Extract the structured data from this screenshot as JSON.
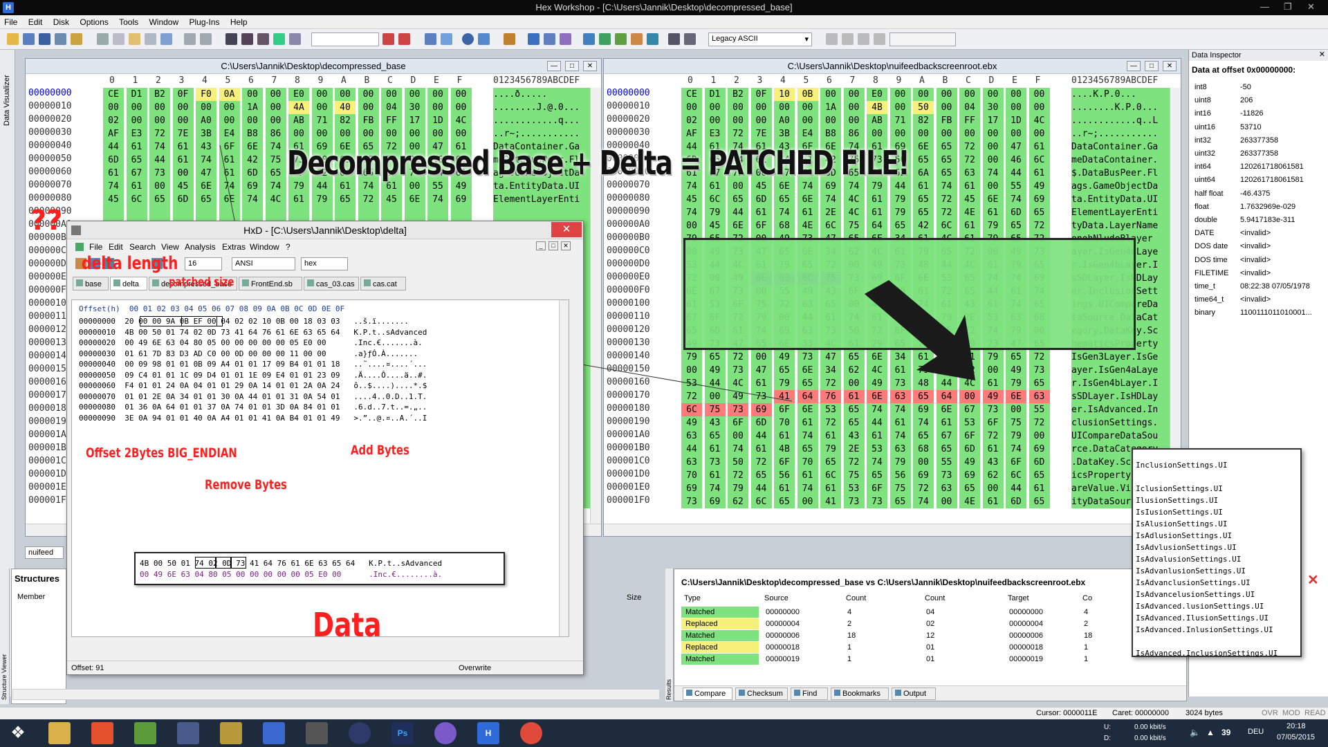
{
  "app": {
    "title": "Hex Workshop - [C:\\Users\\Jannik\\Desktop\\decompressed_base]"
  },
  "menu": [
    "File",
    "Edit",
    "Disk",
    "Options",
    "Tools",
    "Window",
    "Plug-Ins",
    "Help"
  ],
  "toolbar": {
    "encoding": "Legacy ASCII"
  },
  "leftstrip": {
    "label": "Data Visualizer"
  },
  "leftpane": {
    "title": "C:\\Users\\Jannik\\Desktop\\decompressed_base",
    "header_cols": [
      "0",
      "1",
      "2",
      "3",
      "4",
      "5",
      "6",
      "7",
      "8",
      "9",
      "A",
      "B",
      "C",
      "D",
      "E",
      "F"
    ],
    "ascii_head": "0123456789ABCDEF",
    "offsets": [
      "00000000",
      "00000010",
      "00000020",
      "00000030",
      "00000040",
      "00000050",
      "00000060",
      "00000070",
      "00000080",
      "00000090",
      "000000A0",
      "000000B0",
      "000000C0",
      "000000D0",
      "000000E0",
      "000000F0",
      "00000100",
      "00000110",
      "00000120",
      "00000130",
      "00000140",
      "00000150",
      "00000160",
      "00000170",
      "00000180",
      "00000190",
      "000001A0",
      "000001B0",
      "000001C0",
      "000001D0",
      "000001E0",
      "000001F0"
    ],
    "rows": [
      [
        "CE",
        "D1",
        "B2",
        "0F",
        "F0",
        "0A",
        "00",
        "00",
        "E0",
        "00",
        "00",
        "00",
        "00",
        "00",
        "00",
        "00"
      ],
      [
        "00",
        "00",
        "00",
        "00",
        "00",
        "00",
        "1A",
        "00",
        "4A",
        "00",
        "40",
        "00",
        "04",
        "30",
        "00",
        "00"
      ],
      [
        "02",
        "00",
        "00",
        "00",
        "A0",
        "00",
        "00",
        "00",
        "AB",
        "71",
        "82",
        "FB",
        "FF",
        "17",
        "1D",
        "4C"
      ],
      [
        "AF",
        "E3",
        "72",
        "7E",
        "3B",
        "E4",
        "B8",
        "86",
        "00",
        "00",
        "00",
        "00",
        "00",
        "00",
        "00",
        "00"
      ],
      [
        "44",
        "61",
        "74",
        "61",
        "43",
        "6F",
        "6E",
        "74",
        "61",
        "69",
        "6E",
        "65",
        "72",
        "00",
        "47",
        "61"
      ],
      [
        "6D",
        "65",
        "44",
        "61",
        "74",
        "61",
        "42",
        "75",
        "73",
        "50",
        "65",
        "65",
        "72",
        "00",
        "46",
        "6C"
      ],
      [
        "61",
        "67",
        "73",
        "00",
        "47",
        "61",
        "6D",
        "65",
        "4F",
        "62",
        "6A",
        "65",
        "63",
        "74",
        "44",
        "61"
      ],
      [
        "74",
        "61",
        "00",
        "45",
        "6E",
        "74",
        "69",
        "74",
        "79",
        "44",
        "61",
        "74",
        "61",
        "00",
        "55",
        "49"
      ],
      [
        "45",
        "6C",
        "65",
        "6D",
        "65",
        "6E",
        "74",
        "4C",
        "61",
        "79",
        "65",
        "72",
        "45",
        "6E",
        "74",
        "69"
      ]
    ],
    "ascii": [
      "....ð.....",
      "........J.@.0...",
      "............q...",
      "..r~;...........",
      "DataContainer.Ga",
      "meDataBusPeer.Fl",
      "ags.GameObjectDa",
      "ta.EntityData.UI",
      "ElementLayerEnti"
    ]
  },
  "rightpane": {
    "title": "C:\\Users\\Jannik\\Desktop\\nuifeedbackscreenroot.ebx",
    "header_cols": [
      "0",
      "1",
      "2",
      "3",
      "4",
      "5",
      "6",
      "7",
      "8",
      "9",
      "A",
      "B",
      "C",
      "D",
      "E",
      "F"
    ],
    "ascii_head": "0123456789ABCDEF",
    "offsets": [
      "00000000",
      "00000010",
      "00000020",
      "00000030",
      "00000040",
      "00000050",
      "00000060",
      "00000070",
      "00000080",
      "00000090",
      "000000A0",
      "000000B0",
      "000000C0",
      "000000D0",
      "000000E0",
      "000000F0",
      "00000100",
      "00000110",
      "00000120",
      "00000130",
      "00000140",
      "00000150",
      "00000160",
      "00000170",
      "00000180",
      "00000190",
      "000001A0",
      "000001B0",
      "000001C0",
      "000001D0",
      "000001E0",
      "000001F0"
    ],
    "rows": [
      [
        "CE",
        "D1",
        "B2",
        "0F",
        "10",
        "0B",
        "00",
        "00",
        "E0",
        "00",
        "00",
        "00",
        "00",
        "00",
        "00",
        "00"
      ],
      [
        "00",
        "00",
        "00",
        "00",
        "00",
        "00",
        "1A",
        "00",
        "4B",
        "00",
        "50",
        "00",
        "04",
        "30",
        "00",
        "00"
      ],
      [
        "02",
        "00",
        "00",
        "00",
        "A0",
        "00",
        "00",
        "00",
        "AB",
        "71",
        "82",
        "FB",
        "FF",
        "17",
        "1D",
        "4C"
      ],
      [
        "AF",
        "E3",
        "72",
        "7E",
        "3B",
        "E4",
        "B8",
        "86",
        "00",
        "00",
        "00",
        "00",
        "00",
        "00",
        "00",
        "00"
      ],
      [
        "44",
        "61",
        "74",
        "61",
        "43",
        "6F",
        "6E",
        "74",
        "61",
        "69",
        "6E",
        "65",
        "72",
        "00",
        "47",
        "61"
      ],
      [
        "6D",
        "65",
        "44",
        "61",
        "74",
        "61",
        "42",
        "75",
        "73",
        "50",
        "65",
        "65",
        "72",
        "00",
        "46",
        "6C"
      ],
      [
        "61",
        "67",
        "73",
        "00",
        "47",
        "61",
        "6D",
        "65",
        "4F",
        "62",
        "6A",
        "65",
        "63",
        "74",
        "44",
        "61"
      ],
      [
        "74",
        "61",
        "00",
        "45",
        "6E",
        "74",
        "69",
        "74",
        "79",
        "44",
        "61",
        "74",
        "61",
        "00",
        "55",
        "49"
      ],
      [
        "45",
        "6C",
        "65",
        "6D",
        "65",
        "6E",
        "74",
        "4C",
        "61",
        "79",
        "65",
        "72",
        "45",
        "6E",
        "74",
        "69"
      ],
      [
        "74",
        "79",
        "44",
        "61",
        "74",
        "61",
        "2E",
        "4C",
        "61",
        "79",
        "65",
        "72",
        "4E",
        "61",
        "6D",
        "65"
      ],
      [
        "00",
        "45",
        "6E",
        "6F",
        "68",
        "4E",
        "6C",
        "75",
        "64",
        "65",
        "42",
        "6C",
        "61",
        "79",
        "65",
        "72"
      ],
      [
        "79",
        "65",
        "72",
        "00",
        "49",
        "73",
        "47",
        "65",
        "6E",
        "34",
        "61",
        "4C",
        "61",
        "79",
        "65",
        "72"
      ],
      [
        "00",
        "49",
        "73",
        "47",
        "65",
        "6E",
        "34",
        "62",
        "4C",
        "61",
        "79",
        "65",
        "72",
        "00",
        "49",
        "73"
      ],
      [
        "53",
        "44",
        "4C",
        "61",
        "79",
        "65",
        "72",
        "00",
        "49",
        "73",
        "48",
        "44",
        "4C",
        "61",
        "79",
        "65"
      ],
      [
        "72",
        "00",
        "49",
        "6E",
        "63",
        "6C",
        "75",
        "73",
        "69",
        "6F",
        "6E",
        "53",
        "65",
        "74",
        "74",
        "69"
      ],
      [
        "6E",
        "67",
        "73",
        "00",
        "55",
        "49",
        "43",
        "6F",
        "6D",
        "70",
        "61",
        "72",
        "65",
        "44",
        "61",
        "74"
      ],
      [
        "61",
        "53",
        "6F",
        "75",
        "72",
        "63",
        "65",
        "00",
        "44",
        "61",
        "74",
        "61",
        "43",
        "61",
        "74",
        "65"
      ],
      [
        "67",
        "6F",
        "72",
        "79",
        "00",
        "44",
        "61",
        "74",
        "61",
        "4B",
        "65",
        "79",
        "2E",
        "53",
        "63",
        "68"
      ],
      [
        "65",
        "6D",
        "61",
        "74",
        "69",
        "63",
        "73",
        "50",
        "72",
        "6F",
        "70",
        "65",
        "72",
        "74",
        "79",
        "00"
      ],
      [
        "49",
        "73",
        "47",
        "65",
        "6E",
        "33",
        "4C",
        "61",
        "79",
        "65",
        "72",
        "00",
        "49",
        "73",
        "47",
        "65"
      ],
      [
        "79",
        "65",
        "72",
        "00",
        "49",
        "73",
        "47",
        "65",
        "6E",
        "34",
        "61",
        "4C",
        "61",
        "79",
        "65",
        "72"
      ],
      [
        "00",
        "49",
        "73",
        "47",
        "65",
        "6E",
        "34",
        "62",
        "4C",
        "61",
        "79",
        "65",
        "72",
        "00",
        "49",
        "73"
      ],
      [
        "53",
        "44",
        "4C",
        "61",
        "79",
        "65",
        "72",
        "00",
        "49",
        "73",
        "48",
        "44",
        "4C",
        "61",
        "79",
        "65"
      ],
      [
        "72",
        "00",
        "49",
        "73",
        "41",
        "64",
        "76",
        "61",
        "6E",
        "63",
        "65",
        "64",
        "00",
        "49",
        "6E",
        "63"
      ],
      [
        "6C",
        "75",
        "73",
        "69",
        "6F",
        "6E",
        "53",
        "65",
        "74",
        "74",
        "69",
        "6E",
        "67",
        "73",
        "00",
        "55"
      ],
      [
        "49",
        "43",
        "6F",
        "6D",
        "70",
        "61",
        "72",
        "65",
        "44",
        "61",
        "74",
        "61",
        "53",
        "6F",
        "75",
        "72"
      ],
      [
        "63",
        "65",
        "00",
        "44",
        "61",
        "74",
        "61",
        "43",
        "61",
        "74",
        "65",
        "67",
        "6F",
        "72",
        "79",
        "00"
      ],
      [
        "44",
        "61",
        "74",
        "61",
        "4B",
        "65",
        "79",
        "2E",
        "53",
        "63",
        "68",
        "65",
        "6D",
        "61",
        "74",
        "69"
      ],
      [
        "63",
        "73",
        "50",
        "72",
        "6F",
        "70",
        "65",
        "72",
        "74",
        "79",
        "00",
        "55",
        "49",
        "43",
        "6F",
        "6D"
      ],
      [
        "70",
        "61",
        "72",
        "65",
        "56",
        "61",
        "6C",
        "75",
        "65",
        "56",
        "69",
        "73",
        "69",
        "62",
        "6C",
        "65"
      ],
      [
        "69",
        "74",
        "79",
        "44",
        "61",
        "74",
        "61",
        "53",
        "6F",
        "75",
        "72",
        "63",
        "65",
        "00",
        "44",
        "61"
      ],
      [
        "73",
        "69",
        "62",
        "6C",
        "65",
        "00",
        "41",
        "73",
        "73",
        "65",
        "74",
        "00",
        "4E",
        "61",
        "6D",
        "65"
      ]
    ],
    "ascii": [
      "....K.P.0...",
      "........K.P.0...",
      "............q..L",
      "..r~;...........",
      "DataContainer.Ga",
      "meDataContainer.",
      "$.DataBusPeer.Fl",
      "ags.GameObjectDa",
      "ta.EntityData.UI",
      "ElementLayerEnti",
      "tyData.LayerName",
      "enohNludeBlayer",
      "ayer.IsGen4aLaye",
      "r.IsGen4bLayer.I",
      "sSDLayer.IsHDLay",
      "er.InclusionSett",
      "ings.UICompareDa",
      "taSource.DataCat",
      "egory.DataKey.Sc",
      "hematicsProperty",
      "IsGen3Layer.IsGe",
      "ayer.IsGen4aLaye",
      "r.IsGen4bLayer.I",
      "sSDLayer.IsHDLay",
      "er.IsAdvanced.In",
      "clusionSettings.",
      "UICompareDataSou",
      "rce.DataCategory",
      ".DataKey.Schemat",
      "icsProperty.UICo",
      "areValue.Visible",
      "ityDataSource.Da",
      "sible.Asset.Name"
    ]
  },
  "caption": "Decompressed Base + Delta = PATCHED FILE!",
  "annotations": {
    "qq": "??",
    "delta_length": "delta length",
    "patched_size": "patched size",
    "offset": "Offset 2Bytes BIG_ENDIAN",
    "remove": "Remove Bytes",
    "add": "Add Bytes",
    "data": "Data"
  },
  "hxd": {
    "title": "HxD - [C:\\Users\\Jannik\\Desktop\\delta]",
    "menu": [
      "File",
      "Edit",
      "Search",
      "View",
      "Analysis",
      "Extras",
      "Window",
      "?"
    ],
    "bytes_per_row": "16",
    "charset": "ANSI",
    "mode": "hex",
    "tabs": [
      "base",
      "delta",
      "decompressed_base",
      "FrontEnd.sb",
      "cas_03.cas",
      "cas.cat"
    ],
    "header": "Offset(h)  00 01 02 03 04 05 06 07 08 09 0A 0B 0C 0D 0E 0F",
    "lines": [
      "00000000  20 00 00 9A 0B EF 00 04 02 02 10 0B 00 18 03 03   ..š.ï.......",
      "00000010  4B 00 50 01 74 02 0D 73 41 64 76 61 6E 63 65 64   K.P.t..sAdvanced",
      "00000020  00 49 6E 63 04 80 05 00 00 00 00 00 05 E0 00      .Inc.€.......à.",
      "00000030  01 61 7D 83 D3 AD C0 00 0D 00 00 00 11 00 00      .a}ƒÓ.À.......",
      "00000040  00 09 98 01 01 0B 09 A4 01 01 17 09 B4 01 01 18   ..˜....¤....´...",
      "00000050  09 C4 01 01 1C 09 D4 01 01 1E 09 E4 01 01 23 09   .Ä....Ô....ä..#.",
      "00000060  F4 01 01 24 0A 04 01 01 29 0A 14 01 01 2A 0A 24   ô..$....)....*.$",
      "00000070  01 01 2E 0A 34 01 01 30 0A 44 01 01 31 0A 54 01   ....4..0.D..1.T.",
      "00000080  01 36 0A 64 01 01 37 0A 74 01 01 3D 0A 84 01 01   .6.d..7.t..=.„..",
      "00000090  3E 0A 94 01 01 40 0A A4 01 01 41 0A B4 01 01 49   >.”..@.¤..A.´..I"
    ],
    "zoom_line1": "4B 00 50 01 74 02 0D 73 41 64 76 61 6E 63 65 64   K.P.t..sAdvanced",
    "zoom_line2": "00 49 6E 63 04 80 05 00 00 00 00 00 05 E0 00      .Inc.€........à.",
    "status_offset": "Offset: 91",
    "status_mode": "Overwrite"
  },
  "inspector": {
    "title": "Data Inspector",
    "subtitle": "Data at offset 0x00000000:",
    "rows": [
      [
        "int8",
        "-50"
      ],
      [
        "uint8",
        "206"
      ],
      [
        "int16",
        "-11826"
      ],
      [
        "uint16",
        "53710"
      ],
      [
        "int32",
        "263377358"
      ],
      [
        "uint32",
        "263377358"
      ],
      [
        "int64",
        "120261718061581"
      ],
      [
        "uint64",
        "120261718061581"
      ],
      [
        "half float",
        "-46.4375"
      ],
      [
        "float",
        "1.7632969e-029"
      ],
      [
        "double",
        "5.9417183e-311"
      ],
      [
        "DATE",
        "<invalid>"
      ],
      [
        "DOS date",
        "<invalid>"
      ],
      [
        "DOS time",
        "<invalid>"
      ],
      [
        "FILETIME",
        "<invalid>"
      ],
      [
        "time_t",
        "08:22:38 07/05/1978"
      ],
      [
        "time64_t",
        "<invalid>"
      ],
      [
        "binary",
        "1100111011010001..."
      ]
    ]
  },
  "structures": {
    "title": "Structures",
    "member": "Member",
    "size": "Size",
    "side_label": "Structure Viewer"
  },
  "results": {
    "title": "C:\\Users\\Jannik\\Desktop\\decompressed_base vs C:\\Users\\Jannik\\Desktop\\nuifeedbackscreenroot.ebx",
    "side_label": "Results",
    "cols": [
      "Type",
      "Source",
      "Count",
      "Count",
      "Target",
      "Co"
    ],
    "rows": [
      [
        "Matched",
        "00000000",
        "4",
        "04",
        "00000000",
        "4"
      ],
      [
        "Replaced",
        "00000004",
        "2",
        "02",
        "00000004",
        "2"
      ],
      [
        "Matched",
        "00000006",
        "18",
        "12",
        "00000006",
        "18"
      ],
      [
        "Replaced",
        "00000018",
        "1",
        "01",
        "00000018",
        "1"
      ],
      [
        "Matched",
        "00000019",
        "1",
        "01",
        "00000019",
        "1"
      ]
    ],
    "tabs": [
      "Compare",
      "Checksum",
      "Find",
      "Bookmarks",
      "Output"
    ]
  },
  "autocomplete": {
    "lines": [
      "InclusionSettings.UI",
      "",
      "IclusionSettings.UI",
      "IlusionSettings.UI",
      "IsIusionSettings.UI",
      "IsAlusionSettings.UI",
      "IsAdlusionSettings.UI",
      "IsAdvlusionSettings.UI",
      "IsAdvalusionSettings.UI",
      "IsAdvanlusionSettings.UI",
      "IsAdvanclusionSettings.UI",
      "IsAdvancelusionSettings.UI",
      "IsAdvanced.lusionSettings.UI",
      "IsAdvanced.IlusionSettings.UI",
      "IsAdvanced.InlusionSettings.UI",
      "",
      "IsAdvanced.InclusionSettings.UI"
    ]
  },
  "bottom_tab": "nuifeed",
  "status": {
    "cursor": "Cursor: 0000011E",
    "caret": "Caret: 00000000",
    "size": "3024 bytes",
    "ovr": "OVR",
    "mod": "MOD",
    "read": "READ"
  },
  "taskbar": {
    "net_up": "0.00 kbit/s",
    "net_down": "0.00 kbit/s",
    "u": "U:",
    "d": "D:",
    "temp": "39",
    "lang": "DEU",
    "time": "20:18",
    "date": "07/05/2015"
  },
  "colors": {
    "green": "#7ee27e",
    "yellow": "#f7f07a",
    "purple": "#9a2a9a",
    "red": "#ff1f1f",
    "select": "#8f8ff0",
    "pink": "#ff7a7a"
  }
}
